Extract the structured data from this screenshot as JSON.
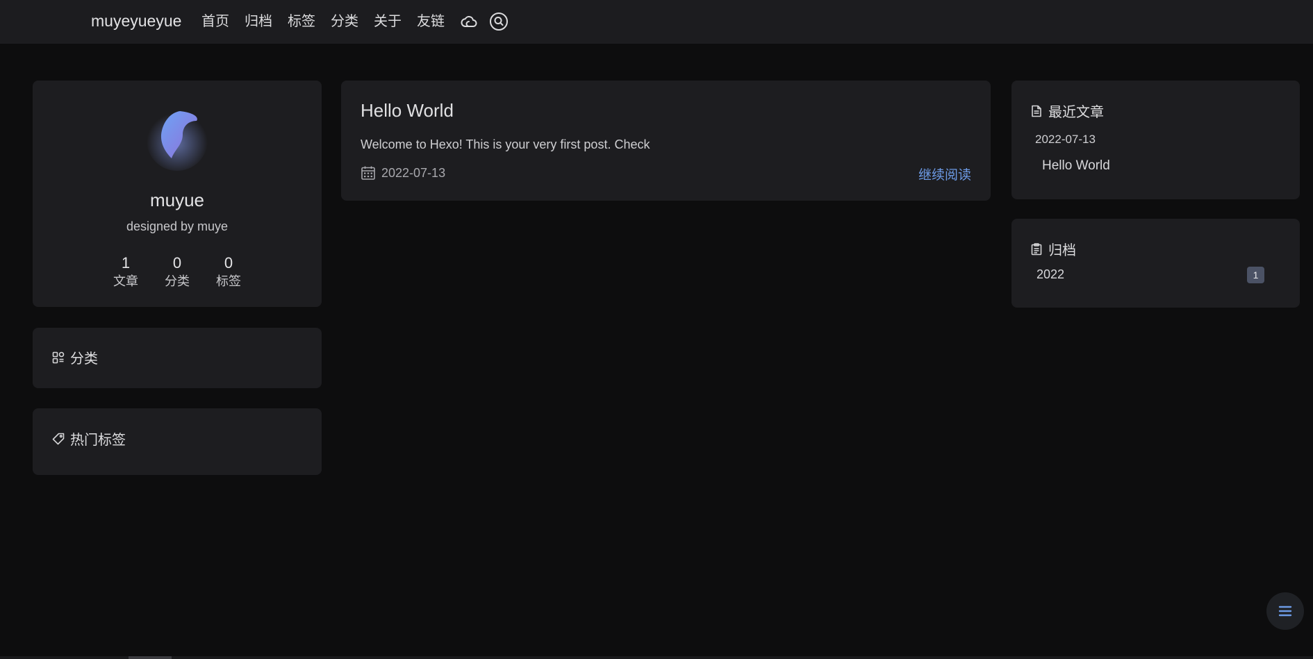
{
  "header": {
    "brand": "muyeyueyue",
    "nav": [
      "首页",
      "归档",
      "标签",
      "分类",
      "关于",
      "友链"
    ]
  },
  "profile": {
    "name": "muyue",
    "description": "designed by muye",
    "stats": [
      {
        "value": "1",
        "label": "文章"
      },
      {
        "value": "0",
        "label": "分类"
      },
      {
        "value": "0",
        "label": "标签"
      }
    ]
  },
  "widgets": {
    "categories_title": "分类",
    "tags_title": "热门标签",
    "recent_title": "最近文章",
    "archive_title": "归档"
  },
  "post": {
    "title": "Hello World",
    "excerpt": "Welcome to Hexo! This is your very first post. Check",
    "date": "2022-07-13",
    "read_more": "继续阅读"
  },
  "recent": {
    "date": "2022-07-13",
    "title": "Hello World"
  },
  "archive": {
    "year": "2022",
    "count": "1"
  },
  "colors": {
    "background": "#0d0d0e",
    "card": "#1d1d20",
    "accent": "#6d9be6",
    "badge": "#4b5265"
  },
  "icons": [
    "cloud-icon",
    "search-icon",
    "category-icon",
    "tag-icon",
    "document-icon",
    "archive-icon",
    "calendar-icon",
    "menu-icon"
  ]
}
